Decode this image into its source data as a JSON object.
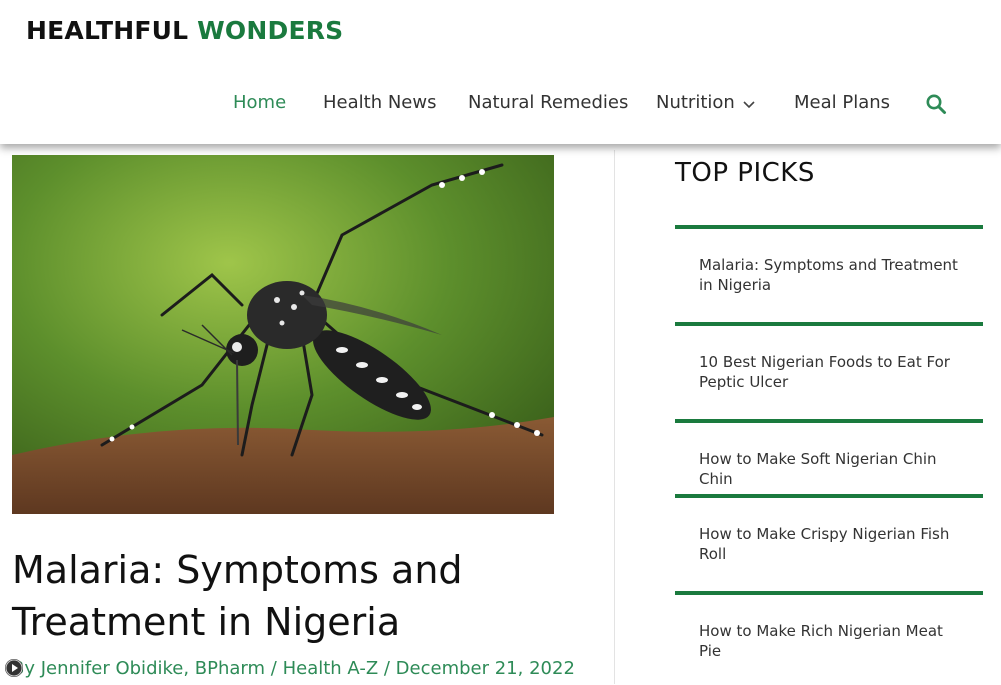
{
  "site": {
    "logo_part1": "HEALTHFUL ",
    "logo_part2": "WONDERS"
  },
  "nav": {
    "items": [
      {
        "label": "Home",
        "active": true
      },
      {
        "label": "Health News"
      },
      {
        "label": "Natural Remedies"
      },
      {
        "label": "Nutrition",
        "has_dropdown": true
      },
      {
        "label": "Meal Plans"
      }
    ],
    "search_icon": "search-icon"
  },
  "article": {
    "image_subject": "mosquito",
    "title_line1": "Malaria: Symptoms and",
    "title_line2": "Treatment in Nigeria",
    "meta_by": "By ",
    "author": "Jennifer Obidike, BPharm",
    "sep1": " / ",
    "category": "Health A-Z",
    "sep2": " / ",
    "date": "December 21, 2022"
  },
  "sidebar": {
    "title": "TOP PICKS",
    "picks": [
      {
        "line1": "Malaria: Symptoms and Treatment",
        "line2": "in Nigeria"
      },
      {
        "line1": "10 Best Nigerian Foods to Eat For",
        "line2": "Peptic Ulcer"
      },
      {
        "line1": "How to Make Soft Nigerian Chin Chin",
        "line2": ""
      },
      {
        "line1": "How to Make Crispy Nigerian Fish",
        "line2": "Roll"
      },
      {
        "line1": "How to Make Rich Nigerian Meat Pie",
        "line2": ""
      }
    ]
  },
  "colors": {
    "accent": "#1a7a3e",
    "link": "#2e8b57"
  }
}
